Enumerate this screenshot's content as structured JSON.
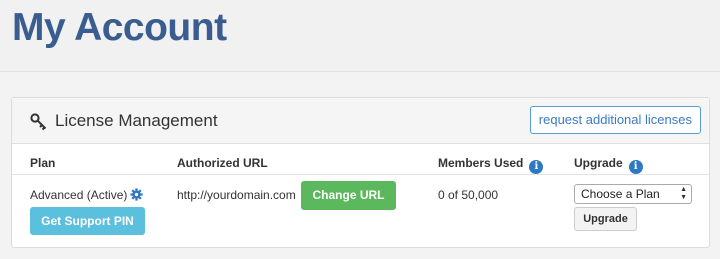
{
  "page": {
    "title": "My Account"
  },
  "panel": {
    "title": "License Management",
    "request_button": "request additional licenses"
  },
  "table": {
    "headers": {
      "plan": "Plan",
      "url": "Authorized URL",
      "members": "Members Used",
      "upgrade": "Upgrade"
    },
    "row": {
      "plan": "Advanced (Active)",
      "support_button": "Get Support PIN",
      "url": "http://yourdomain.com",
      "change_button": "Change URL",
      "members": "0 of 50,000",
      "plan_select": "Choose a Plan",
      "upgrade_button": "Upgrade"
    }
  },
  "icons": {
    "key": "key-icon",
    "info": "info-icon",
    "gear": "gear-icon",
    "select_arrow": "chevron-updown-icon"
  },
  "colors": {
    "title": "#3a5d8f",
    "info": "#2f79c4",
    "support_button": "#5bc0de",
    "change_button": "#5cb85c",
    "request_button_border": "#5b9bd5"
  }
}
